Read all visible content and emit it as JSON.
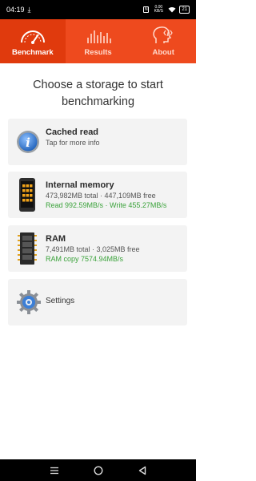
{
  "status_bar": {
    "time": "04:19",
    "download_glyph": "⤓",
    "net_speed": "0.00 KB/S",
    "battery": "21"
  },
  "tabs": [
    {
      "label": "Benchmark",
      "icon": "speedometer-icon",
      "active": true
    },
    {
      "label": "Results",
      "icon": "bars-chart-icon",
      "active": false
    },
    {
      "label": "About",
      "icon": "head-code-icon",
      "active": false
    }
  ],
  "heading": "Choose a storage to start benchmarking",
  "storages": [
    {
      "title": "Cached read",
      "subtitle": "Tap for more info",
      "icon": "info-icon"
    },
    {
      "title": "Internal memory",
      "subtitle": "473,982MB total · 447,109MB free",
      "speeds": "Read 992.59MB/s · Write 455.27MB/s",
      "icon": "phone-memory-icon"
    },
    {
      "title": "RAM",
      "subtitle": "7,491MB total · 3,025MB free",
      "speeds": "RAM copy 7574.94MB/s",
      "icon": "ram-chip-icon"
    }
  ],
  "settings": {
    "label": "Settings",
    "icon": "gear-icon"
  },
  "nav": {
    "menu": "recent-apps-icon",
    "home": "home-icon",
    "back": "back-icon"
  },
  "colors": {
    "accent": "#ee4a1e",
    "accent_dark": "#e03a0d",
    "green": "#3aa23a"
  }
}
